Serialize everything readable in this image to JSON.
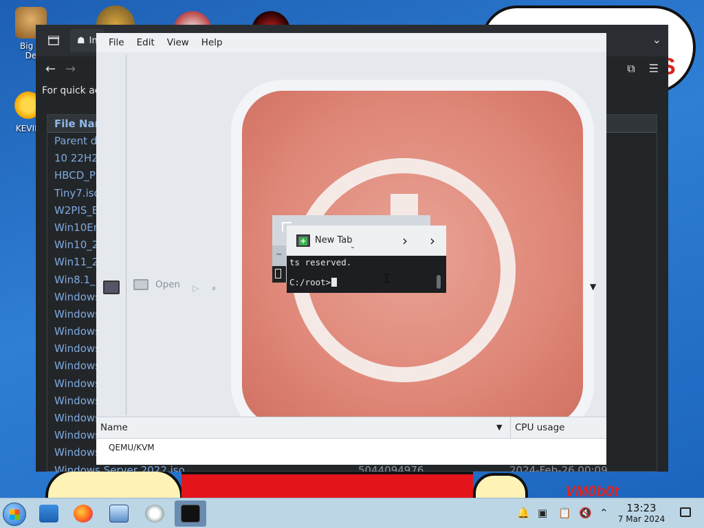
{
  "desktop": {
    "icons": [
      {
        "label": "Big N\nDe"
      },
      {
        "label": "KEVIN"
      }
    ],
    "wallpaper_text_right": "S",
    "wallpaper_brand": "VM0b0t"
  },
  "file_manager": {
    "tab_title": "In",
    "hint": "For quick ac",
    "columns": {
      "name": "File Nam"
    },
    "rows": [
      {
        "name": "Parent di",
        "size": "",
        "date": ""
      },
      {
        "name": "10 22H2",
        "size": "",
        "date": ""
      },
      {
        "name": "HBCD_P",
        "size": "",
        "date": ""
      },
      {
        "name": "Tiny7.iso",
        "size": "",
        "date": ""
      },
      {
        "name": "W2PIS_E",
        "size": "",
        "date": ""
      },
      {
        "name": "Win10En",
        "size": "",
        "date": ""
      },
      {
        "name": "Win10_2",
        "size": "",
        "date": ""
      },
      {
        "name": "Win11_22",
        "size": "",
        "date": ""
      },
      {
        "name": "Win8.1_E",
        "size": "",
        "date": ""
      },
      {
        "name": "Windows",
        "size": "",
        "date": ""
      },
      {
        "name": "Windows",
        "size": "",
        "date": ""
      },
      {
        "name": "Windows",
        "size": "",
        "date": ""
      },
      {
        "name": "Windows",
        "size": "",
        "date": ""
      },
      {
        "name": "Windows",
        "size": "",
        "date": ""
      },
      {
        "name": "Windows",
        "size": "",
        "date": ""
      },
      {
        "name": "Windows",
        "size": "",
        "date": ""
      },
      {
        "name": "Windows",
        "size": "",
        "date": ""
      },
      {
        "name": "Windows",
        "size": "",
        "date": ""
      },
      {
        "name": "Windows",
        "size": "",
        "date": ""
      },
      {
        "name": "Windows Server 2022.iso",
        "size": "5044094976",
        "date": "2024-Feb-26 00:09"
      }
    ]
  },
  "task_manager": {
    "menu": [
      "File",
      "Edit",
      "View",
      "Help"
    ],
    "toolbar": {
      "open_label": "Open"
    },
    "columns": {
      "name": "Name",
      "cpu": "CPU usage"
    },
    "rows": [
      {
        "name": "QEMU/KVM"
      }
    ]
  },
  "terminal": {
    "tab_label": "New Tab",
    "ghost_tab_label": "~",
    "lines": [
      "ts reserved.",
      "C:/root>"
    ]
  },
  "taskbar": {
    "clock_time": "13:23",
    "clock_date": "7 Mar 2024",
    "apps": [
      "start",
      "file-explorer",
      "firefox",
      "control-panel",
      "virt-manager",
      "terminal"
    ]
  },
  "colors": {
    "taskbar": "#bcd6e6",
    "file_manager_bg": "#232629",
    "task_manager_bg": "#dde2e8",
    "link_blue": "#7fa9df"
  }
}
